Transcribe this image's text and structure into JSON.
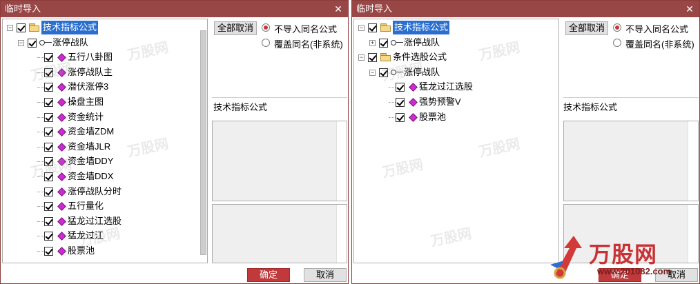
{
  "left": {
    "title": "临时导入",
    "tree": [
      {
        "label": "技术指标公式",
        "icon": "folder-icon",
        "level": 0,
        "expander": "minus",
        "selected": true
      },
      {
        "label": "涨停战队",
        "icon": "key-icon",
        "level": 1,
        "expander": "minus"
      },
      {
        "label": "五行八卦图",
        "icon": "diamond-icon",
        "level": 2
      },
      {
        "label": "涨停战队主",
        "icon": "diamond-icon",
        "level": 2
      },
      {
        "label": "潜伏涨停3",
        "icon": "diamond-icon",
        "level": 2
      },
      {
        "label": "操盘主图",
        "icon": "diamond-icon",
        "level": 2
      },
      {
        "label": "资金统计",
        "icon": "diamond-icon",
        "level": 2
      },
      {
        "label": "资金墙ZDM",
        "icon": "diamond-icon",
        "level": 2
      },
      {
        "label": "资金墙JLR",
        "icon": "diamond-icon",
        "level": 2
      },
      {
        "label": "资金墙DDY",
        "icon": "diamond-icon",
        "level": 2
      },
      {
        "label": "资金墙DDX",
        "icon": "diamond-icon",
        "level": 2
      },
      {
        "label": "涨停战队分时",
        "icon": "diamond-icon",
        "level": 2
      },
      {
        "label": "五行量化",
        "icon": "diamond-icon",
        "level": 2
      },
      {
        "label": "猛龙过江选股",
        "icon": "diamond-icon",
        "level": 2
      },
      {
        "label": "猛龙过江",
        "icon": "diamond-icon",
        "level": 2
      },
      {
        "label": "股票池",
        "icon": "diamond-icon",
        "level": 2
      }
    ],
    "deselect_all": "全部取消",
    "radio_no_import": "不导入同名公式",
    "radio_overwrite": "覆盖同名(非系统)",
    "section": "技术指标公式",
    "ok": "确定",
    "cancel": "取消"
  },
  "right": {
    "title": "临时导入",
    "tree": [
      {
        "label": "技术指标公式",
        "icon": "folder-icon",
        "level": 0,
        "expander": "minus",
        "selected": true
      },
      {
        "label": "涨停战队",
        "icon": "key-icon",
        "level": 1,
        "expander": "plus"
      },
      {
        "label": "条件选股公式",
        "icon": "folder-icon",
        "level": 0,
        "expander": "minus"
      },
      {
        "label": "涨停战队",
        "icon": "key-icon",
        "level": 1,
        "expander": "minus"
      },
      {
        "label": "猛龙过江选股",
        "icon": "diamond-icon",
        "level": 2
      },
      {
        "label": "强势预警V",
        "icon": "diamond-icon",
        "level": 2
      },
      {
        "label": "股票池",
        "icon": "diamond-icon",
        "level": 2
      }
    ],
    "deselect_all": "全部取消",
    "radio_no_import": "不导入同名公式",
    "radio_overwrite": "覆盖同名(非系统)",
    "section": "技术指标公式",
    "ok": "确定",
    "cancel": "取消"
  },
  "watermark": {
    "text": "万股网",
    "url": "www.201082.com"
  },
  "colors": {
    "titlebar": "#984646",
    "accent": "#c0393b",
    "selection": "#2a6fcf",
    "formula_icon": "#cc2bd1"
  }
}
